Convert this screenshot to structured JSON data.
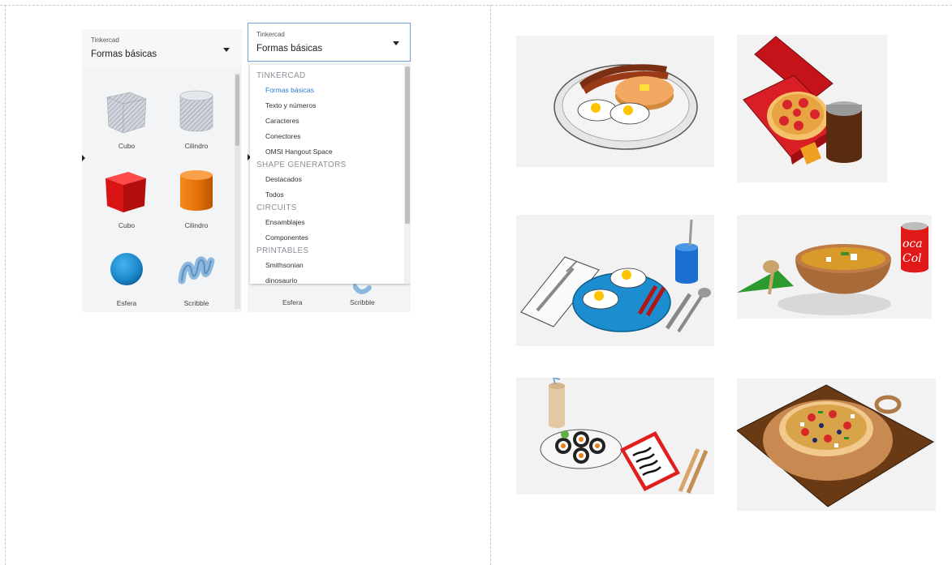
{
  "left_panel": {
    "app_label": "Tinkercad",
    "selected_category": "Formas básicas",
    "shapes": [
      {
        "label": "Cubo",
        "icon": "cube-striped-icon"
      },
      {
        "label": "Cilindro",
        "icon": "cylinder-striped-icon"
      },
      {
        "label": "Cubo",
        "icon": "cube-red-icon"
      },
      {
        "label": "Cilindro",
        "icon": "cylinder-orange-icon"
      },
      {
        "label": "Esfera",
        "icon": "sphere-blue-icon"
      },
      {
        "label": "Scribble",
        "icon": "scribble-icon"
      }
    ]
  },
  "right_panel": {
    "app_label": "Tinkercad",
    "selected_category": "Formas básicas",
    "dropdown": {
      "sections": [
        {
          "heading": "TINKERCAD",
          "items": [
            "Formas básicas",
            "Texto y números",
            "Caracteres",
            "Conectores",
            "OMSI Hangout Space"
          ]
        },
        {
          "heading": "SHAPE GENERATORS",
          "items": [
            "Destacados",
            "Todos"
          ]
        },
        {
          "heading": "CIRCUITS",
          "items": [
            "Ensamblajes",
            "Componentes"
          ]
        },
        {
          "heading": "PRINTABLES",
          "items": [
            "Smithsonian",
            "dinosaurio"
          ]
        }
      ],
      "active_item": "Formas básicas"
    },
    "visible_shapes": [
      {
        "label": "Esfera"
      },
      {
        "label": "Scribble"
      }
    ]
  },
  "gallery": [
    {
      "name": "breakfast-plate"
    },
    {
      "name": "pizza-box-and-drink"
    },
    {
      "name": "egg-breakfast-place-setting"
    },
    {
      "name": "soup-bowl-and-cola"
    },
    {
      "name": "sushi-set"
    },
    {
      "name": "pizza-on-board"
    }
  ],
  "gallery_text": {
    "cola_text": "Coca Cola"
  },
  "colors": {
    "accent_blue": "#2a7ad6",
    "cube_red": "#e31b1b",
    "cylinder_orange": "#f07e12",
    "sphere_blue": "#1f8fd6",
    "scribble_blue": "#7fb0d8"
  }
}
